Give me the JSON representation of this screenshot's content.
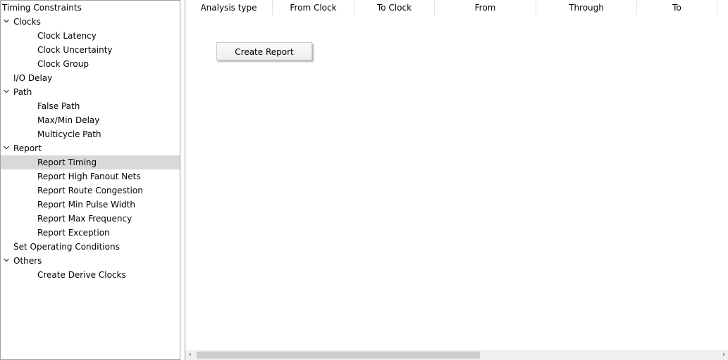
{
  "tree": {
    "items": [
      {
        "label": "Timing Constraints",
        "level": 0,
        "expander": false,
        "selected": false
      },
      {
        "label": "Clocks",
        "level": 1,
        "expander": true,
        "selected": false
      },
      {
        "label": "Clock Latency",
        "level": 2,
        "expander": false,
        "selected": false
      },
      {
        "label": "Clock Uncertainty",
        "level": 2,
        "expander": false,
        "selected": false
      },
      {
        "label": "Clock Group",
        "level": 2,
        "expander": false,
        "selected": false
      },
      {
        "label": "I/O Delay",
        "level": 1,
        "expander": false,
        "selected": false
      },
      {
        "label": "Path",
        "level": 1,
        "expander": true,
        "selected": false
      },
      {
        "label": "False Path",
        "level": 2,
        "expander": false,
        "selected": false
      },
      {
        "label": "Max/Min Delay",
        "level": 2,
        "expander": false,
        "selected": false
      },
      {
        "label": "Multicycle Path",
        "level": 2,
        "expander": false,
        "selected": false
      },
      {
        "label": "Report",
        "level": 1,
        "expander": true,
        "selected": false
      },
      {
        "label": "Report Timing",
        "level": 2,
        "expander": false,
        "selected": true
      },
      {
        "label": "Report High Fanout Nets",
        "level": 2,
        "expander": false,
        "selected": false
      },
      {
        "label": "Report Route Congestion",
        "level": 2,
        "expander": false,
        "selected": false
      },
      {
        "label": "Report Min Pulse Width",
        "level": 2,
        "expander": false,
        "selected": false
      },
      {
        "label": "Report Max Frequency",
        "level": 2,
        "expander": false,
        "selected": false
      },
      {
        "label": "Report Exception",
        "level": 2,
        "expander": false,
        "selected": false
      },
      {
        "label": "Set Operating Conditions",
        "level": 1,
        "expander": false,
        "selected": false
      },
      {
        "label": "Others",
        "level": 1,
        "expander": true,
        "selected": false
      },
      {
        "label": "Create Derive Clocks",
        "level": 2,
        "expander": false,
        "selected": false
      }
    ]
  },
  "table": {
    "columns": [
      "Analysis type",
      "From Clock",
      "To Clock",
      "From",
      "Through",
      "To"
    ]
  },
  "main": {
    "create_report_label": "Create Report"
  },
  "scrollbar": {
    "left_icon": "chevron-left-icon",
    "right_icon": "chevron-right-icon"
  },
  "colors": {
    "selection": "#d9d9d9",
    "border": "#a0a0a0"
  }
}
